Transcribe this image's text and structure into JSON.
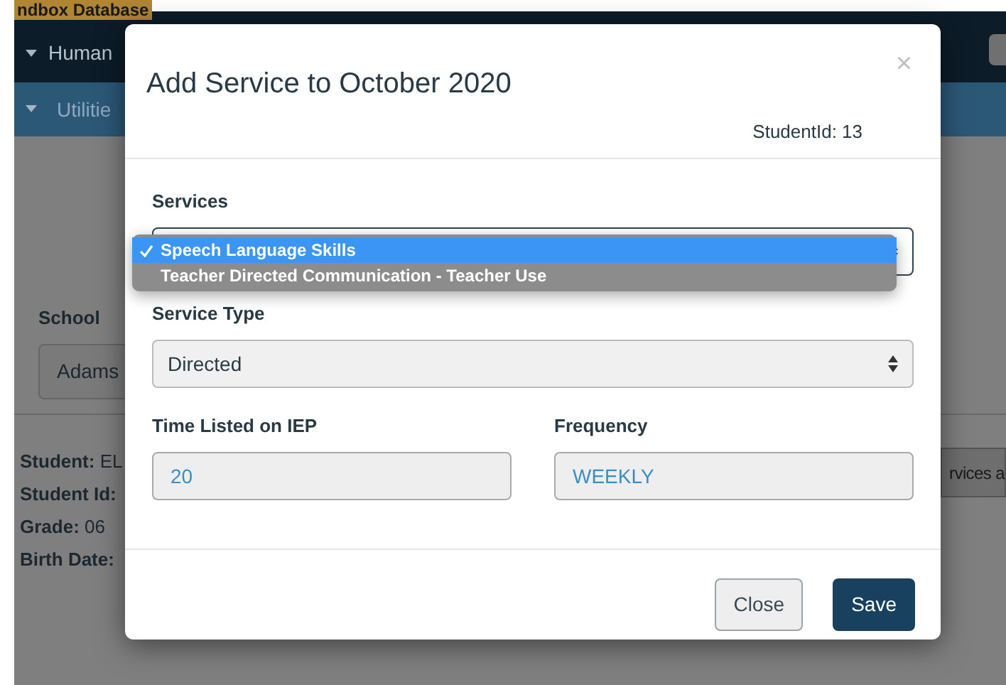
{
  "banner": {
    "text": "ndbox Database"
  },
  "nav": {
    "items": [
      {
        "label": "Human"
      }
    ]
  },
  "subnav": {
    "items": [
      {
        "label": "Utilitie"
      }
    ]
  },
  "filter": {
    "label": "School",
    "value": "Adams"
  },
  "student_info": [
    "**Student:** EL",
    "**Student Id:**",
    "**Grade:** 06",
    "**Birth Date:**"
  ],
  "side_button": {
    "label": "rvices a"
  },
  "modal": {
    "title": "Add Service to October 2020",
    "close": "×",
    "student_id": "StudentId: 13",
    "fields": [
      {
        "kind": "select",
        "label": "Services",
        "open": true,
        "options": [
          {
            "label": "Speech Language Skills",
            "selected": true
          },
          {
            "label": "Teacher Directed Communication - Teacher Use",
            "selected": false
          }
        ]
      },
      {
        "kind": "select",
        "label": "Service Type",
        "value": "Directed"
      },
      {
        "kind": "input",
        "label": "Time Listed on IEP",
        "value": "20"
      },
      {
        "kind": "input",
        "label": "Frequency",
        "value": "WEEKLY"
      }
    ],
    "buttons": [
      {
        "label": "Close",
        "kind": "secondary"
      },
      {
        "label": "Save",
        "kind": "primary"
      }
    ]
  }
}
